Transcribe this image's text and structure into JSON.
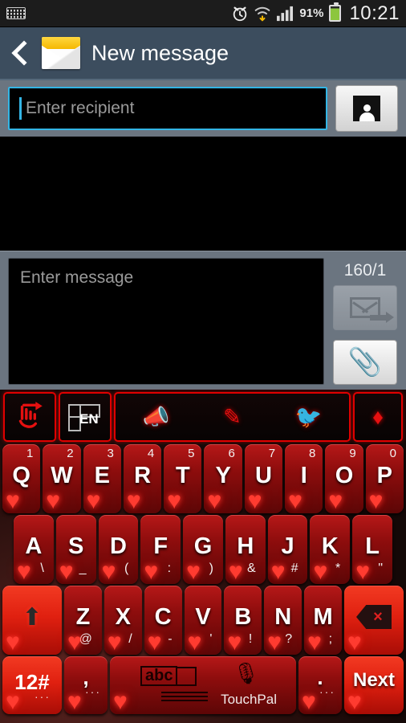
{
  "statusbar": {
    "keyboard_icon": "keyboard-icon",
    "alarm_icon": "alarm-clock-icon",
    "wifi_icon": "wifi-download-icon",
    "signal_icon": "signal-bars-icon",
    "battery_percent": "91%",
    "battery_icon": "battery-icon",
    "time": "10:21"
  },
  "actionbar": {
    "back_icon": "back-chevron-icon",
    "app_icon": "envelope-icon",
    "title": "New message"
  },
  "recipient": {
    "placeholder": "Enter recipient",
    "value": "",
    "contact_button_icon": "contact-person-icon"
  },
  "compose": {
    "message_placeholder": "Enter message",
    "message_value": "",
    "counter": "160/1",
    "send_icon": "send-envelope-icon",
    "attach_icon": "paperclip-icon",
    "attach_glyph": "📎"
  },
  "keyboard": {
    "toolbar": [
      {
        "name": "swipe-gesture-key",
        "icon": "hand-swipe-icon",
        "glyph": "☞"
      },
      {
        "name": "language-key",
        "icon": "keyboard-layout-icon",
        "label": "EN"
      },
      {
        "name": "voice-broadcast-key",
        "icon": "megaphone-icon",
        "glyph": "📣"
      },
      {
        "name": "handwriting-key",
        "icon": "pen-icon",
        "glyph": "✎"
      },
      {
        "name": "twitter-key",
        "icon": "twitter-bird-icon",
        "glyph": "🐦"
      },
      {
        "name": "theme-key",
        "icon": "diamond-icon",
        "glyph": "♦"
      }
    ],
    "heart_glyph": "♥",
    "rows": [
      [
        {
          "main": "Q",
          "num": "1"
        },
        {
          "main": "W",
          "num": "2"
        },
        {
          "main": "E",
          "num": "3"
        },
        {
          "main": "R",
          "num": "4"
        },
        {
          "main": "T",
          "num": "5"
        },
        {
          "main": "Y",
          "num": "6"
        },
        {
          "main": "U",
          "num": "7"
        },
        {
          "main": "I",
          "num": "8"
        },
        {
          "main": "O",
          "num": "9"
        },
        {
          "main": "P",
          "num": "0"
        }
      ],
      [
        {
          "main": "A",
          "sym": "\\"
        },
        {
          "main": "S",
          "sym": "_"
        },
        {
          "main": "D",
          "sym": "("
        },
        {
          "main": "F",
          "sym": ":"
        },
        {
          "main": "G",
          "sym": ")"
        },
        {
          "main": "H",
          "sym": "&"
        },
        {
          "main": "J",
          "sym": "#"
        },
        {
          "main": "K",
          "sym": "*"
        },
        {
          "main": "L",
          "sym": "\""
        }
      ],
      [
        {
          "main": "Z",
          "sym": "@"
        },
        {
          "main": "X",
          "sym": "/"
        },
        {
          "main": "C",
          "sym": "-"
        },
        {
          "main": "V",
          "sym": "'"
        },
        {
          "main": "B",
          "sym": "!"
        },
        {
          "main": "N",
          "sym": "?"
        },
        {
          "main": "M",
          "sym": ";"
        }
      ]
    ],
    "shift": {
      "name": "shift-key",
      "icon": "shift-arrow-icon",
      "glyph": "⬆"
    },
    "backspace": {
      "name": "backspace-key",
      "icon": "backspace-icon",
      "glyph": "×"
    },
    "symbols_key": {
      "label": "12#",
      "dots": "···"
    },
    "comma_key": {
      "label": ",",
      "dots": "···"
    },
    "space_key": {
      "abc_label": "abc",
      "brand": "TouchPal",
      "mic_icon": "microphone-icon",
      "mic_glyph": "🎙"
    },
    "period_key": {
      "label": ".",
      "dots": "···"
    },
    "enter_key": {
      "label": "Next"
    }
  }
}
